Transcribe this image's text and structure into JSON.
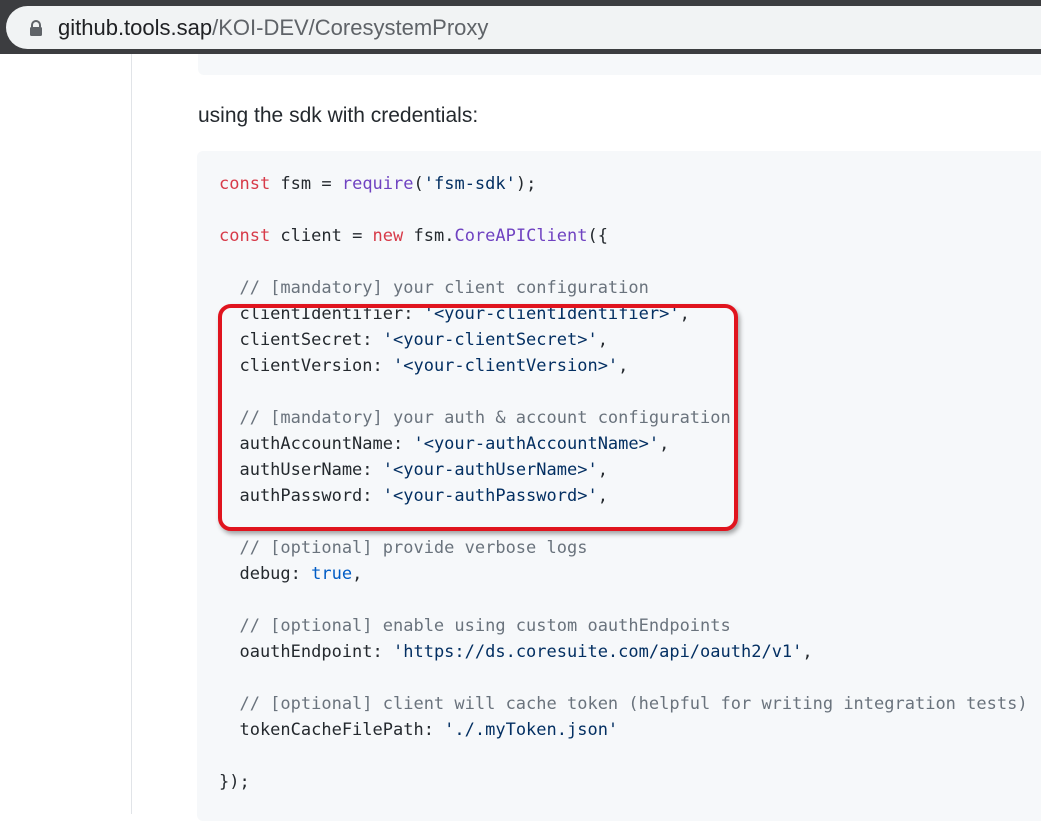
{
  "browser": {
    "url_host": "github.tools.sap",
    "url_path": "/KOI-DEV/CoresystemProxy",
    "lock_icon": "lock-icon"
  },
  "page": {
    "intro_text": "using the sdk with credentials:"
  },
  "code": {
    "l1": [
      "const",
      " fsm = ",
      "require",
      "(",
      "'fsm-sdk'",
      ");"
    ],
    "l3": [
      "const",
      " client = ",
      "new",
      " fsm.",
      "CoreAPIClient",
      "({"
    ],
    "l5": "  // [mandatory] your client configuration",
    "l6": [
      "  clientIdentifier: ",
      "'<your-clientIdentifier>'",
      ","
    ],
    "l7": [
      "  clientSecret: ",
      "'<your-clientSecret>'",
      ","
    ],
    "l8": [
      "  clientVersion: ",
      "'<your-clientVersion>'",
      ","
    ],
    "l10": "  // [mandatory] your auth & account configuration",
    "l11": [
      "  authAccountName: ",
      "'<your-authAccountName>'",
      ","
    ],
    "l12": [
      "  authUserName: ",
      "'<your-authUserName>'",
      ","
    ],
    "l13": [
      "  authPassword: ",
      "'<your-authPassword>'",
      ","
    ],
    "l15": "  // [optional] provide verbose logs",
    "l16": [
      "  debug: ",
      "true",
      ","
    ],
    "l18": "  // [optional] enable using custom oauthEndpoints",
    "l19": [
      "  oauthEndpoint: ",
      "'https://ds.coresuite.com/api/oauth2/v1'",
      ","
    ],
    "l21": "  // [optional] client will cache token (helpful for writing integration tests)",
    "l22": [
      "  tokenCacheFilePath: ",
      "'./.myToken.json'"
    ],
    "l24": "});"
  },
  "colors": {
    "keyword": "#d73a49",
    "function": "#6f42c1",
    "string": "#032f62",
    "comment": "#6a737d",
    "constant": "#005cc5",
    "highlight_border": "#e0141e"
  }
}
